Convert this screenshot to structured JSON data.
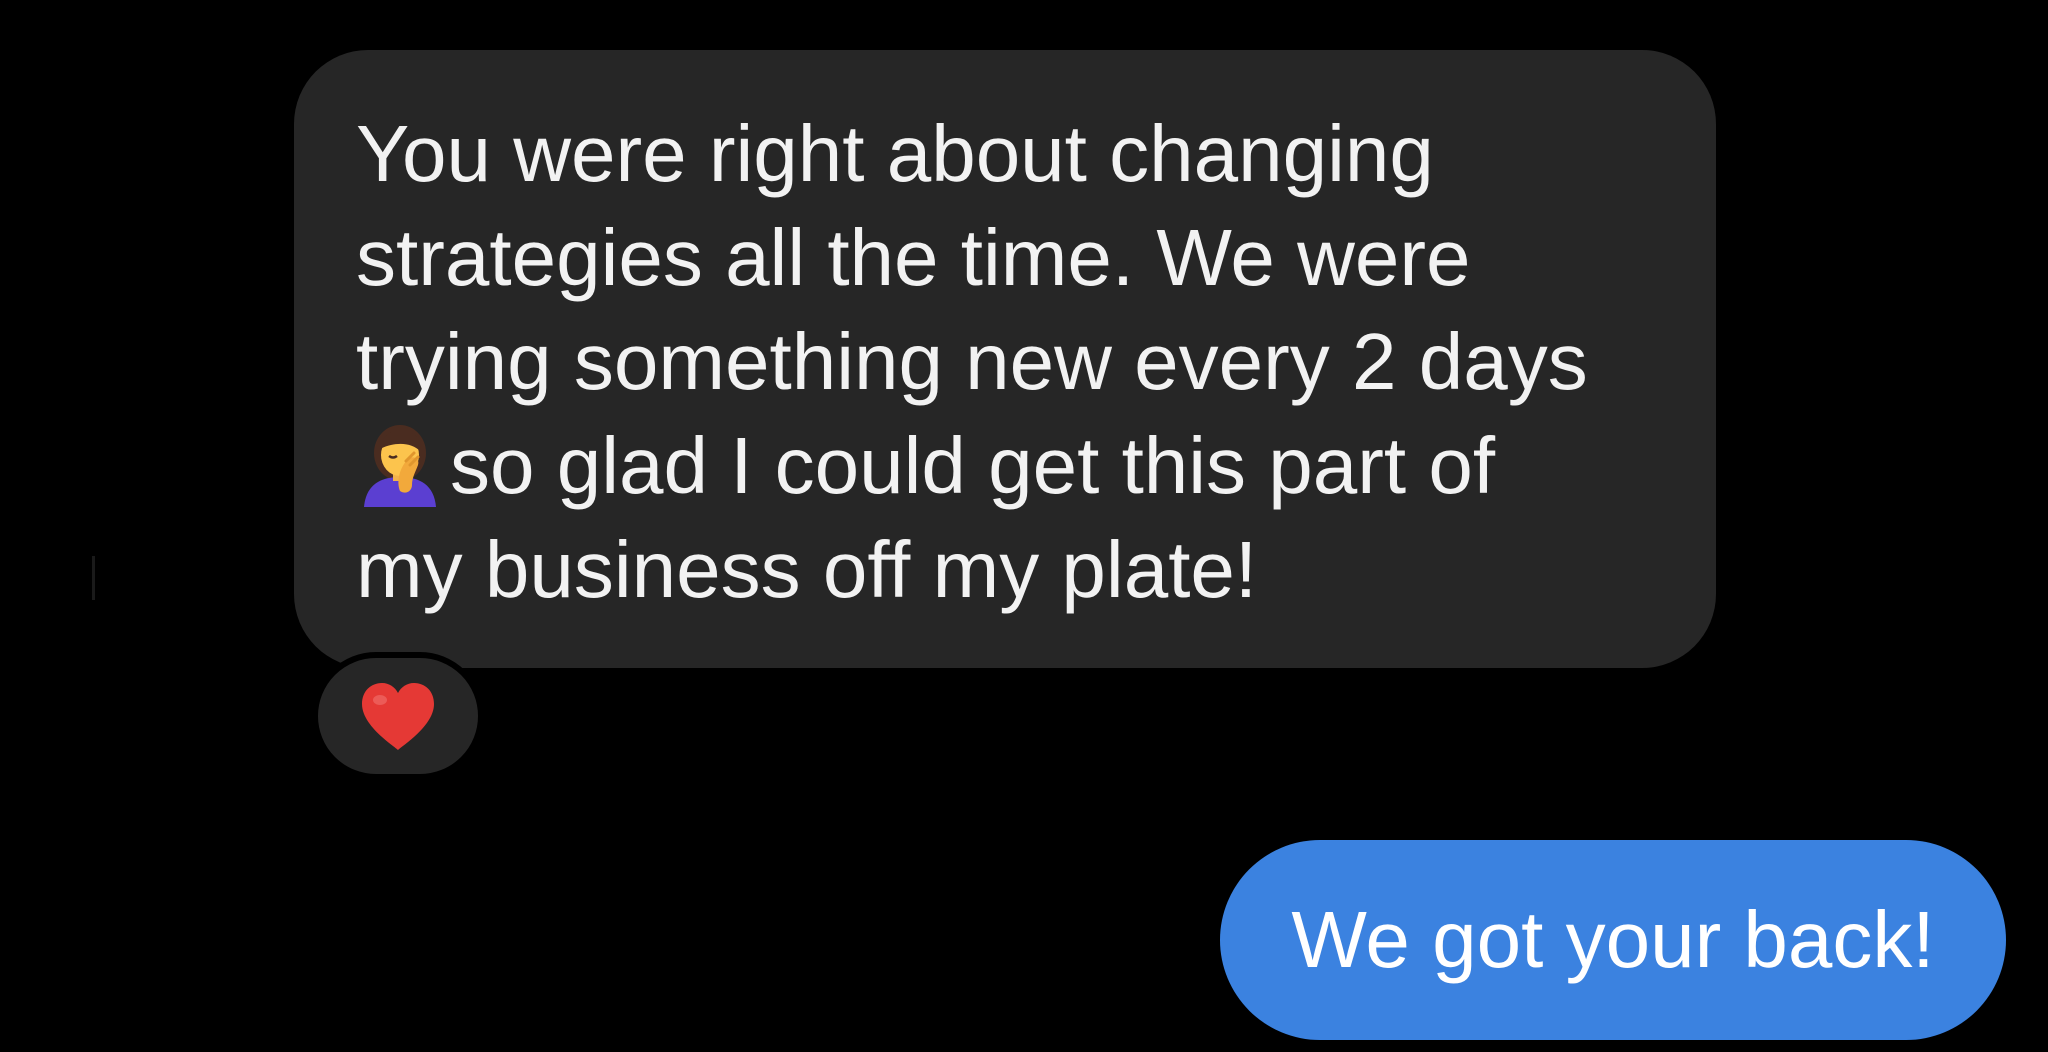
{
  "conversation": {
    "incoming_message": {
      "lines": [
        "You were right about changing",
        "strategies all the time. We were",
        "trying something new every 2 days",
        "so glad I could get this part of",
        "my business off my plate!"
      ],
      "inline_emoji": "woman-facepalming-emoji",
      "reaction": "heart-icon"
    },
    "outgoing_message": {
      "text": "We got your back!"
    }
  },
  "colors": {
    "background": "#000000",
    "incoming_bubble": "#262626",
    "outgoing_bubble": "#3b82e0",
    "heart": "#e53935"
  }
}
